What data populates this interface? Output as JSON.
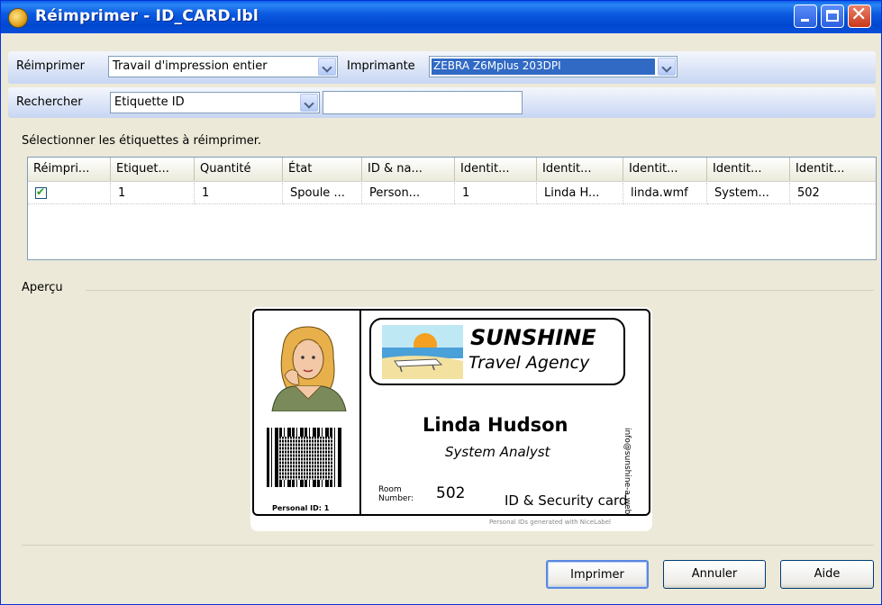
{
  "window": {
    "title": "Réimprimer - ID_CARD.lbl",
    "colors": {
      "titlebar": "#0a5fe8",
      "close": "#c8381a",
      "selection": "#316ac5"
    }
  },
  "toolbar1": {
    "reprint_label": "Réimprimer",
    "reprint_value": "Travail d'impression entier",
    "printer_label": "Imprimante",
    "printer_value": "ZEBRA Z6Mplus 203DPI"
  },
  "toolbar2": {
    "search_label": "Rechercher",
    "search_field_value": "Etiquette ID",
    "search_text": ""
  },
  "instruction": "Sélectionner les étiquettes à réimprimer.",
  "table": {
    "columns": [
      "Réimpri...",
      "Etiquet...",
      "Quantité",
      "État",
      "ID & na...",
      "Identit...",
      "Identit...",
      "Identit...",
      "Identit...",
      "Identit..."
    ],
    "rows": [
      {
        "checked": true,
        "cells": [
          "",
          "1",
          "1",
          "Spoule ...",
          "Person...",
          "1",
          "Linda H...",
          "linda.wmf",
          "System...",
          "502"
        ]
      }
    ]
  },
  "preview": {
    "group_label": "Aperçu",
    "label": {
      "company": "SUNSHINE",
      "company_sub": "Travel Agency",
      "name": "Linda Hudson",
      "job_title": "System Analyst",
      "room_label": "Room Number:",
      "room_number": "502",
      "card_type": "ID & Security card",
      "personal_id": "Personal ID: 1",
      "side_text": "info@sunshine-a.web",
      "footer": "Personal IDs generated with NiceLabel"
    }
  },
  "buttons": {
    "print": "Imprimer",
    "cancel": "Annuler",
    "help": "Aide"
  }
}
